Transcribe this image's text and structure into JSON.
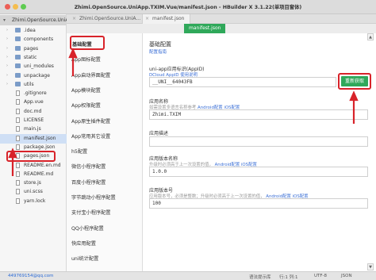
{
  "window": {
    "title": "Zhimi.OpenSource.UniApp.TXIM.Vue/manifest.json - HBuilder X 3.1.22(单项目窗体)"
  },
  "tabs": [
    {
      "label": "Zhimi.OpenSource.UniA..."
    },
    {
      "label": "manifest.json"
    }
  ],
  "subtab": {
    "label": "manifest.json"
  },
  "tree": {
    "project": "Zhimi.OpenSource.UniA...",
    "items": [
      {
        "label": ".idea",
        "type": "folder"
      },
      {
        "label": "components",
        "type": "folder"
      },
      {
        "label": "pages",
        "type": "folder"
      },
      {
        "label": "static",
        "type": "folder"
      },
      {
        "label": "uni_modules",
        "type": "folder"
      },
      {
        "label": "unpackage",
        "type": "folder"
      },
      {
        "label": "utils",
        "type": "folder"
      },
      {
        "label": ".gitignore",
        "type": "file"
      },
      {
        "label": "App.vue",
        "type": "file"
      },
      {
        "label": "doc.md",
        "type": "file"
      },
      {
        "label": "LICENSE",
        "type": "file"
      },
      {
        "label": "main.js",
        "type": "file"
      },
      {
        "label": "manifest.json",
        "type": "file"
      },
      {
        "label": "package.json",
        "type": "file"
      },
      {
        "label": "pages.json",
        "type": "file"
      },
      {
        "label": "README.en.md",
        "type": "file"
      },
      {
        "label": "README.md",
        "type": "file"
      },
      {
        "label": "store.js",
        "type": "file"
      },
      {
        "label": "uni.scss",
        "type": "file"
      },
      {
        "label": "yarn.lock",
        "type": "file"
      }
    ]
  },
  "menu": {
    "items": [
      "基础配置",
      "App图标配置",
      "App启动界面配置",
      "App模块配置",
      "App权限配置",
      "App原生插件配置",
      "App常用其它设置",
      "h5配置",
      "微信小程序配置",
      "百度小程序配置",
      "字节跳动小程序配置",
      "支付宝小程序配置",
      "QQ小程序配置",
      "快应用配置",
      "uni统计配置"
    ]
  },
  "content": {
    "title": "基础配置",
    "guide_link": "配置指南",
    "appid_label": "uni-app应用标识(AppID)",
    "appid_hint_prefix": "DCloud AppID",
    "appid_hint_link": "使用说明",
    "appid_value": "__UNI__64043FB",
    "reget_button": "重新获取",
    "name_label": "应用名称",
    "name_hint_prefix": "如需设置多语言名称参考",
    "name_hint_android": "Android配置",
    "name_hint_ios": "iOS配置",
    "name_value": "Zhimi.TXIM",
    "desc_label": "应用描述",
    "desc_value": "",
    "version_label": "应用版本名称",
    "version_hint_prefix": "升级时必须高于上一次设置的值，",
    "version_hint_android": "Android配置",
    "version_hint_ios": "iOS配置",
    "version_value": "1.0.0",
    "vcode_label": "应用版本号",
    "vcode_hint_prefix": "应用版本号，必须是整数；升级时必须高于上一次设置的值，",
    "vcode_hint_android": "Android配置",
    "vcode_hint_ios": "iOS配置",
    "vcode_value": "100"
  },
  "status": {
    "user": "449769154@qq.com",
    "items": [
      "语法提示库",
      "行:1 列:1",
      "UTF-8",
      "JSON"
    ]
  },
  "colors": {
    "accent_green": "#2fa85a",
    "highlight_red": "#d8232a",
    "link_blue": "#3b6fd6"
  }
}
